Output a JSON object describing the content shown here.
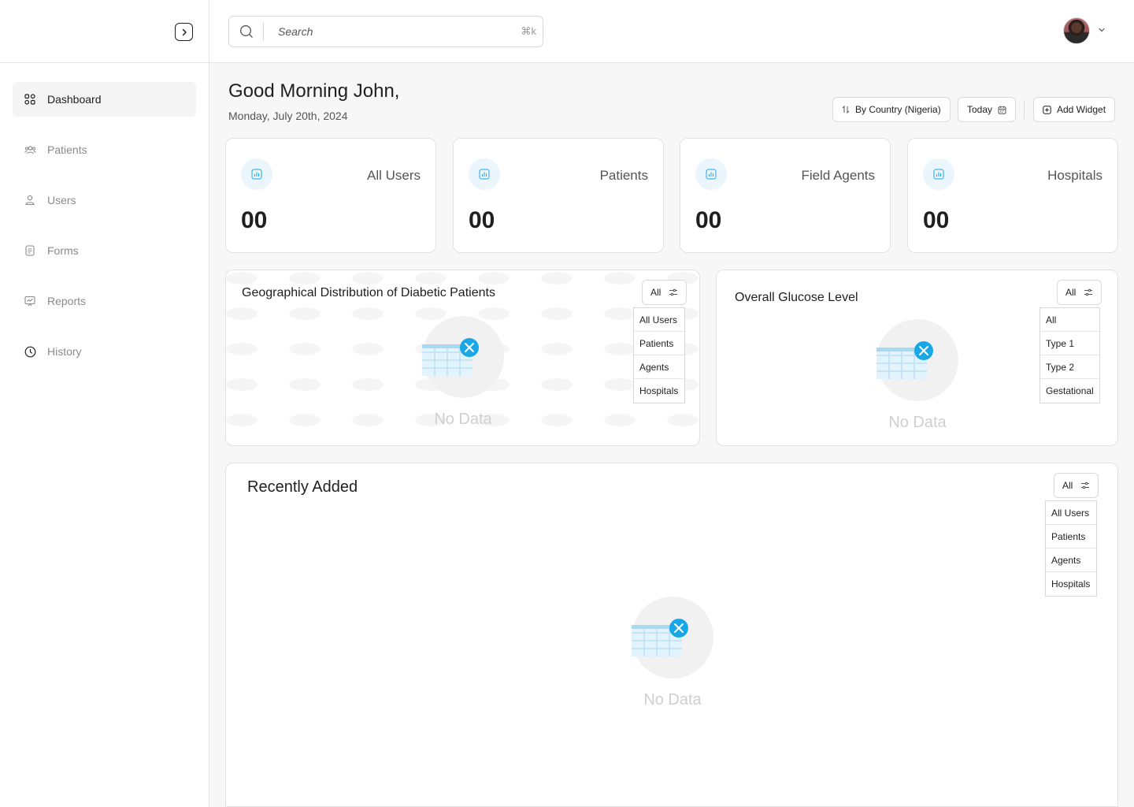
{
  "topbar": {
    "search_placeholder": "Search",
    "search_shortcut": "⌘k"
  },
  "sidebar": {
    "items": [
      {
        "label": "Dashboard",
        "icon": "grid-icon",
        "active": true
      },
      {
        "label": "Patients",
        "icon": "people-icon"
      },
      {
        "label": "Users",
        "icon": "user-icon"
      },
      {
        "label": "Forms",
        "icon": "document-icon"
      },
      {
        "label": "Reports",
        "icon": "report-icon"
      },
      {
        "label": "History",
        "icon": "clock-icon"
      }
    ]
  },
  "header": {
    "greeting": "Good Morning John,",
    "date": "Monday, July 20th, 2024",
    "filter_country": "By Country (Nigeria)",
    "filter_date": "Today",
    "add_widget": "Add Widget"
  },
  "stats": [
    {
      "label": "All Users",
      "value": "00"
    },
    {
      "label": "Patients",
      "value": "00"
    },
    {
      "label": "Field Agents",
      "value": "00"
    },
    {
      "label": "Hospitals",
      "value": "00"
    }
  ],
  "geo_panel": {
    "title": "Geographical Distribution of Diabetic Patients",
    "filter": "All",
    "options": [
      "All Users",
      "Patients",
      "Agents",
      "Hospitals"
    ],
    "empty_text": "No Data"
  },
  "glucose_panel": {
    "title": "Overall Glucose Level",
    "filter": "All",
    "options": [
      "All",
      "Type 1",
      "Type 2",
      "Gestational"
    ],
    "empty_text": "No Data"
  },
  "recent_panel": {
    "title": "Recently Added",
    "filter": "All",
    "options": [
      "All Users",
      "Patients",
      "Agents",
      "Hospitals"
    ],
    "empty_text": "No Data"
  },
  "colors": {
    "accent": "#1aa7e8",
    "icon_bg": "#eaf5fc",
    "border": "#e2e2e2"
  }
}
